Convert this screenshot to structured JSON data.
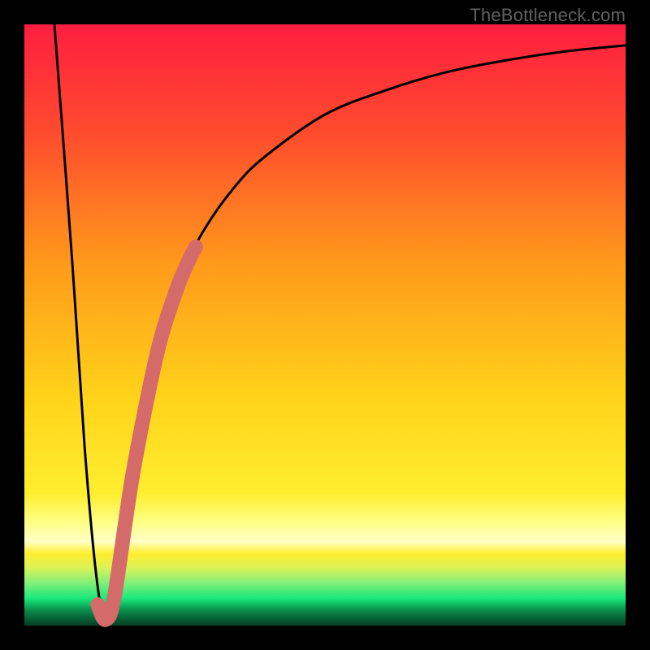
{
  "watermark": "TheBottleneck.com",
  "colors": {
    "top": "#ff1a3e",
    "orange": "#ff9a1a",
    "yellow": "#ffe91a",
    "paleyellow": "#ffff8a",
    "green": "#17e87a",
    "black": "#000000",
    "curve": "#000000",
    "pinkStroke": "#d56a6a"
  },
  "chart_data": {
    "type": "line",
    "title": "",
    "xlabel": "",
    "ylabel": "",
    "xlim": [
      0,
      100
    ],
    "ylim": [
      0,
      100
    ],
    "series": [
      {
        "name": "bottleneck-curve",
        "x": [
          5,
          8,
          10,
          12,
          13.5,
          15,
          18,
          22,
          26,
          30,
          35,
          40,
          50,
          60,
          70,
          80,
          90,
          100
        ],
        "values": [
          100,
          60,
          30,
          8,
          1,
          5,
          25,
          45,
          58,
          66,
          73,
          78,
          85,
          89,
          92,
          94,
          95.5,
          96.5
        ]
      },
      {
        "name": "pink-highlight",
        "x": [
          12.2,
          13.5,
          15,
          18,
          22,
          25,
          27,
          28.5
        ],
        "values": [
          3.5,
          1,
          5,
          25,
          45,
          55,
          60,
          63
        ]
      }
    ],
    "notes": "V-shaped bottleneck curve; minimum near x≈13.5. Background is a vertical red→orange→yellow→green gradient. Pink thick segment highlights the right wall of the dip."
  }
}
